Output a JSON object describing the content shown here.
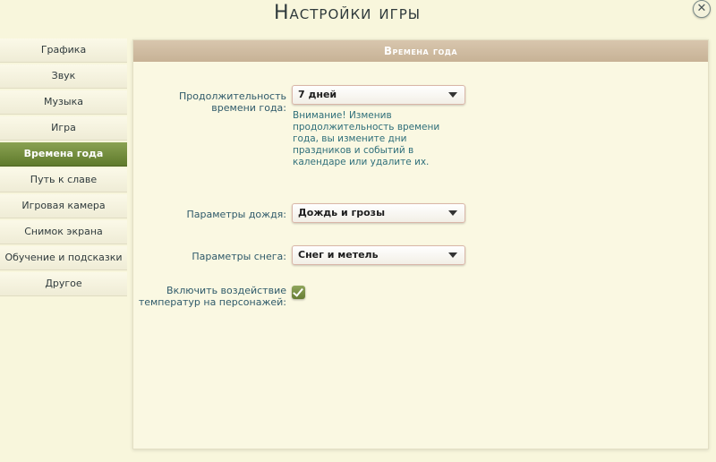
{
  "window": {
    "title": "Настройки игры",
    "close_label": "✕"
  },
  "sidebar": {
    "items": [
      {
        "label": "Графика",
        "active": false
      },
      {
        "label": "Звук",
        "active": false
      },
      {
        "label": "Музыка",
        "active": false
      },
      {
        "label": "Игра",
        "active": false
      },
      {
        "label": "Времена года",
        "active": true
      },
      {
        "label": "Путь к славе",
        "active": false
      },
      {
        "label": "Игровая камера",
        "active": false
      },
      {
        "label": "Снимок экрана",
        "active": false
      },
      {
        "label": "Обучение и подсказки",
        "active": false
      },
      {
        "label": "Другое",
        "active": false
      }
    ]
  },
  "panel": {
    "header": "Времена года",
    "season_length": {
      "label_line1": "Продолжительность",
      "label_line2": "времени года:",
      "value": "7 дней",
      "warning": "Внимание! Изменив продолжительность времени года, вы измените дни праздников и событий в календаре или удалите их."
    },
    "rain": {
      "label": "Параметры дождя:",
      "value": "Дождь и грозы"
    },
    "snow": {
      "label": "Параметры снега:",
      "value": "Снег и метель"
    },
    "temperature": {
      "label_line1": "Включить воздействие",
      "label_line2": "температур на персонажей:",
      "checked": true
    }
  },
  "colors": {
    "background": "#f8f6dc",
    "active_tab": "#6f8a3a",
    "panel_header": "#cfbca2",
    "label_text": "#2f5a6a"
  }
}
